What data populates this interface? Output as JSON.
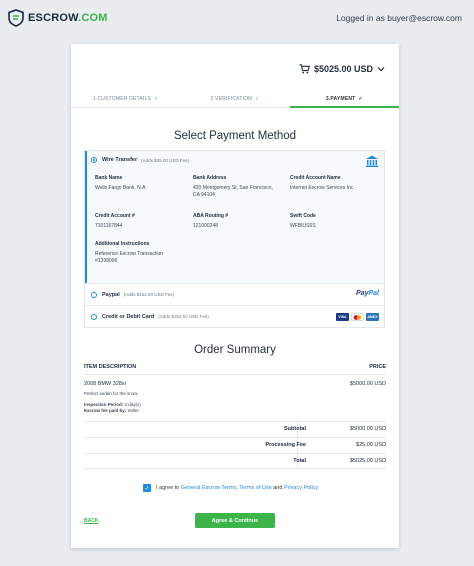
{
  "header": {
    "logo_text": "ESCROW",
    "logo_suffix": ".COM",
    "logged_in": "Logged in as buyer@escrow.com"
  },
  "cart": {
    "total": "$5025.00 USD"
  },
  "steps": [
    {
      "label": "1.CUSTOMER DETAILS",
      "done": true
    },
    {
      "label": "2.VERIFICATION",
      "done": true
    },
    {
      "label": "3.PAYMENT",
      "done": true,
      "active": true
    }
  ],
  "payment": {
    "title": "Select Payment Method",
    "wire": {
      "title": "Wire Transfer",
      "fee": "(Adds $25.00 USD Fee)",
      "bank_name_label": "Bank Name",
      "bank_name": "Wells Fargo Bank, N.A",
      "bank_address_label": "Bank Address",
      "bank_address": "420 Montgomery St, San Francisco, CA 94104",
      "credit_account_name_label": "Credit Account Name",
      "credit_account_name": "Internet Escrow Services Inc",
      "credit_account_label": "Credit Account #",
      "credit_account": "7101167844",
      "aba_label": "ABA Routing #",
      "aba": "121000248",
      "swift_label": "Swift Code",
      "swift": "WFBIUS6S",
      "additional_label": "Additional Instructions",
      "additional": "Reference Escrow Transaction #1399006"
    },
    "paypal": {
      "title": "Paypal",
      "fee": "(Adds $152.50 USD Fee)",
      "logo1": "Pay",
      "logo2": "Pal"
    },
    "card": {
      "title": "Credit or Debit Card",
      "fee": "(Adds $152.50 USD Fee)",
      "visa": "VISA",
      "amex": "AMEX"
    }
  },
  "order": {
    "title": "Order Summary",
    "col_desc": "ITEM DESCRIPTION",
    "col_price": "PRICE",
    "item_name": "2008 BMW 328xi",
    "item_price": "$5000.00 USD",
    "item_desc": "Perfect sedan for the snow",
    "inspection_label": "Inspection Period:",
    "inspection_value": "3 day(s)",
    "fee_paid_label": "Escrow fee paid by:",
    "fee_paid_value": "Seller",
    "subtotal_label": "Subtotal",
    "subtotal": "$5000.00 USD",
    "processing_label": "Processing Fee",
    "processing": "$25.00 USD",
    "total_label": "Total",
    "total": "$5025.00 USD"
  },
  "agree": {
    "prefix": "I agree to",
    "link1": "General Escrow Terms",
    "comma": ",",
    "link2": "Terms of Use",
    "and": "and",
    "link3": "Privacy Policy"
  },
  "actions": {
    "back": "BACK",
    "continue": "Agree & Continue"
  },
  "colors": {
    "accent_green": "#3cb44a",
    "accent_blue": "#1f8ae0"
  }
}
